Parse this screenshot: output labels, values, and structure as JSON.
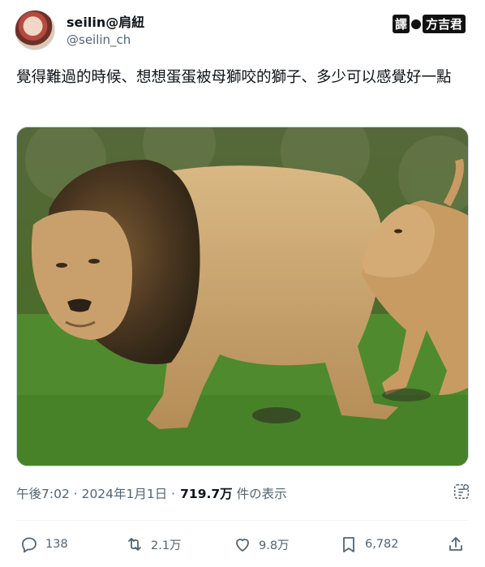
{
  "author": {
    "name": "seilin@肩紐",
    "handle": "@seilin_ch"
  },
  "badge": {
    "left": "譯",
    "right": "方吉君"
  },
  "tweet": {
    "text": "覺得難過的時候、想想蛋蛋被母獅咬的獅子、多少可以感覺好一點"
  },
  "meta": {
    "time_date": "午後7:02 · 2024年1月1日 ·",
    "views": "719.7万",
    "views_label": "件の表示"
  },
  "actions": {
    "replies": "138",
    "retweets": "2.1万",
    "likes": "9.8万",
    "bookmarks": "6,782"
  },
  "icons": {
    "reply": "reply-icon",
    "retweet": "retweet-icon",
    "like": "heart-icon",
    "bookmark": "bookmark-icon",
    "share": "share-icon",
    "translate": "translate-icon"
  }
}
